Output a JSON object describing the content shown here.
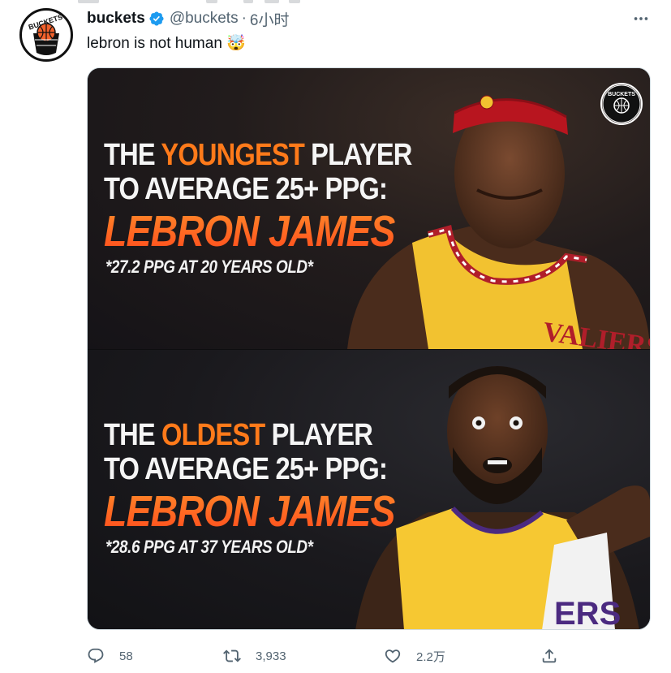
{
  "author": {
    "name": "buckets",
    "handle": "@buckets",
    "separator": "·",
    "time": "6小时",
    "avatar_icon": "buckets-logo-icon",
    "verified_icon": "verified-badge-icon"
  },
  "tweet": {
    "text": "lebron is not human 🤯"
  },
  "media": {
    "top": {
      "line1_pre": "THE ",
      "line1_accent": "YOUNGEST",
      "line1_post": " PLAYER",
      "line2": "TO AVERAGE 25+ PPG:",
      "name": "LEBRON JAMES",
      "stat": "*27.2 PPG AT 20 YEARS OLD*"
    },
    "bottom": {
      "line1_pre": "THE ",
      "line1_accent": "OLDEST",
      "line1_post": " PLAYER",
      "line2": "TO AVERAGE 25+ PPG:",
      "name": "LEBRON JAMES",
      "stat": "*28.6 PPG AT 37 YEARS OLD*"
    },
    "brand_logo_text": "BUCKETS",
    "colors": {
      "accent": "#ff7a1a",
      "name_gradient_top": "#ff8a2a",
      "name_gradient_bottom": "#ff4a1c"
    }
  },
  "actions": {
    "reply": {
      "icon": "reply-icon",
      "count": "58"
    },
    "retweet": {
      "icon": "retweet-icon",
      "count": "3,933"
    },
    "like": {
      "icon": "heart-icon",
      "count": "2.2万"
    },
    "share": {
      "icon": "share-icon"
    }
  },
  "more_icon": "more-options-icon"
}
